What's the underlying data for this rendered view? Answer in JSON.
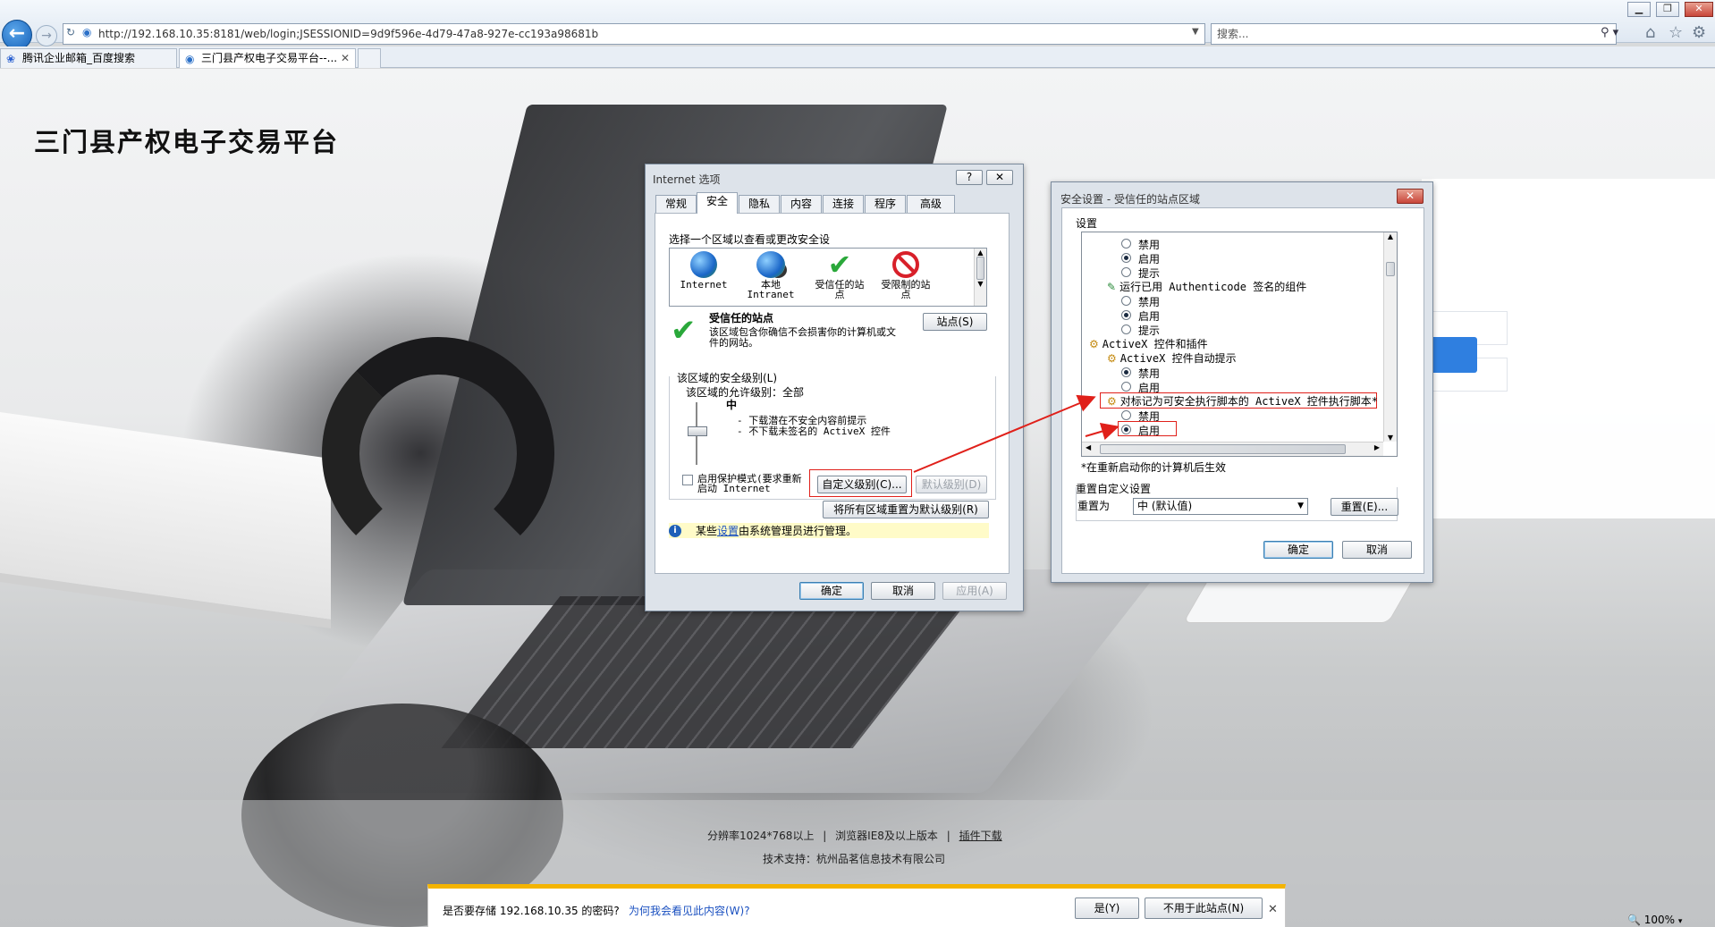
{
  "browser": {
    "url": "http://192.168.10.35:8181/web/login;JSESSIONID=9d9f596e-4d79-47a8-927e-cc193a98681b",
    "search_placeholder": "搜索...",
    "tabs": [
      {
        "label": "腾讯企业邮箱_百度搜索"
      },
      {
        "label": "三门县产权电子交易平台--..."
      }
    ],
    "zoom": "100%"
  },
  "page": {
    "title": "三门县产权电子交易平台",
    "footer": {
      "resolution": "分辨率1024*768以上",
      "browser_req": "浏览器IE8及以上版本",
      "plugin_link": "插件下载",
      "support": "技术支持：杭州品茗信息技术有限公司"
    }
  },
  "internet_options": {
    "title": "Internet 选项",
    "tabs": [
      "常规",
      "安全",
      "隐私",
      "内容",
      "连接",
      "程序",
      "高级"
    ],
    "zone_prompt": "选择一个区域以查看或更改安全设",
    "zones": [
      {
        "label": "Internet",
        "icon": "globe-icon"
      },
      {
        "label": "本地\nIntranet",
        "icon": "intranet-icon"
      },
      {
        "label": "受信任的站\n点",
        "icon": "check-icon"
      },
      {
        "label": "受限制的站\n点",
        "icon": "blocked-icon"
      }
    ],
    "zone_heading": "受信任的站点",
    "zone_desc": "该区域包含你确信不会损害你的计算机或文\n件的网站。",
    "sites_button": "站点(S)",
    "security_level_label": "该区域的安全级别(L)",
    "allowed_levels": "该区域的允许级别：全部",
    "level_name": "中",
    "level_bullets": [
      "- 下载潜在不安全内容前提示",
      "- 不下载未签名的 ActiveX 控件"
    ],
    "protected_mode": "启用保护模式(要求重新\n启动 Internet",
    "custom_level_button": "自定义级别(C)...",
    "default_level_button": "默认级别(D)",
    "reset_all_button": "将所有区域重置为默认级别(R)",
    "info_prefix": "某些",
    "info_link": "设置",
    "info_suffix": "由系统管理员进行管理。",
    "ok": "确定",
    "cancel": "取消",
    "apply": "应用(A)"
  },
  "security_settings": {
    "title": "安全设置 - 受信任的站点区域",
    "settings_label": "设置",
    "items": [
      {
        "text": "禁用",
        "type": "radio",
        "checked": false
      },
      {
        "text": "启用",
        "type": "radio",
        "checked": true
      },
      {
        "text": "提示",
        "type": "radio",
        "checked": false
      },
      {
        "text": "运行已用 Authenticode 签名的组件",
        "type": "header"
      },
      {
        "text": "禁用",
        "type": "radio",
        "checked": false
      },
      {
        "text": "启用",
        "type": "radio",
        "checked": true
      },
      {
        "text": "提示",
        "type": "radio",
        "checked": false
      },
      {
        "text": "ActiveX 控件和插件",
        "type": "category"
      },
      {
        "text": "ActiveX 控件自动提示",
        "type": "header"
      },
      {
        "text": "禁用",
        "type": "radio",
        "checked": true
      },
      {
        "text": "启用",
        "type": "radio",
        "checked": false
      },
      {
        "text": "对标记为可安全执行脚本的 ActiveX 控件执行脚本*",
        "type": "header"
      },
      {
        "text": "禁用",
        "type": "radio",
        "checked": false
      },
      {
        "text": "启用",
        "type": "radio",
        "checked": true
      }
    ],
    "restart_note": "*在重新启动你的计算机后生效",
    "reset_group_label": "重置自定义设置",
    "reset_to_label": "重置为",
    "reset_select_value": "中 (默认值)",
    "reset_button": "重置(E)...",
    "ok": "确定",
    "cancel": "取消"
  },
  "notification": {
    "message": "是否要存储 192.168.10.35 的密码?",
    "why_link": "为何我会看见此内容(W)?",
    "yes": "是(Y)",
    "never": "不用于此站点(N)"
  }
}
